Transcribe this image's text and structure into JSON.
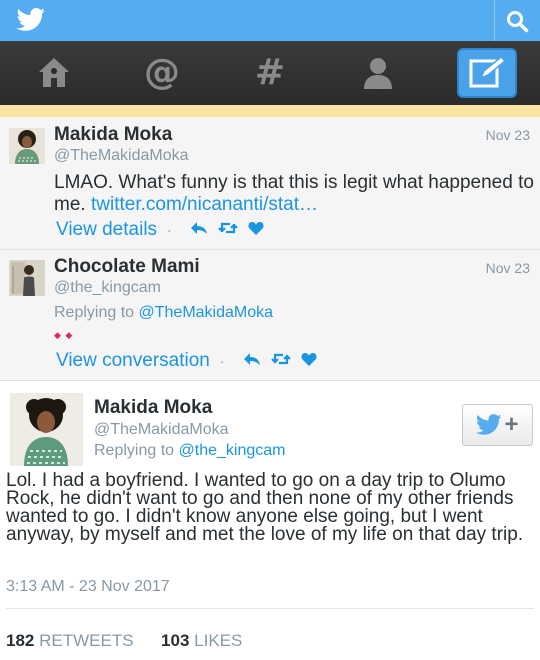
{
  "colors": {
    "topbar": "#55acee",
    "navbar": "#2b2b2b",
    "accent": "#1b95e0",
    "highlight": "#fbe5a2"
  },
  "header": {
    "icons": [
      "twitter-bird-icon",
      "search-icon"
    ]
  },
  "nav": {
    "items": [
      "home-icon",
      "mentions-icon",
      "hashtag-icon",
      "profile-icon",
      "compose-icon"
    ],
    "active": "compose-icon"
  },
  "timeline": [
    {
      "name": "Makida Moka",
      "handle": "@TheMakidaMoka",
      "date": "Nov 23",
      "text": "LMAO. What's funny is that this is legit what happened to me.",
      "link": "twitter.com/nicananti/stat…",
      "action_label": "View details"
    },
    {
      "name": "Chocolate Mami",
      "handle": "@the_kingcam",
      "date": "Nov 23",
      "replying_prefix": "Replying to",
      "replying_to": "@TheMakidaMoka",
      "action_label": "View conversation"
    }
  ],
  "focused_tweet": {
    "name": "Makida Moka",
    "handle": "@TheMakidaMoka",
    "replying_prefix": "Replying to",
    "replying_to": "@the_kingcam",
    "text": "Lol. I had a boyfriend. I wanted to go on a day trip to Olumo Rock, he didn't want to go and then none of my other friends wanted to go. I didn't know anyone else going, but I went anyway, by myself and met the love of my life on that day trip.",
    "timestamp": "3:13 AM - 23 Nov 2017",
    "retweets": "182",
    "retweets_label": "RETWEETS",
    "likes": "103",
    "likes_label": "LIKES",
    "follow_symbol": "+"
  }
}
